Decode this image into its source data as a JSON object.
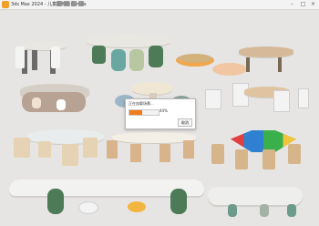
{
  "window": {
    "title": "3ds Max 2024 - 儿童桌椅组合.max",
    "controls": [
      "–",
      "□",
      "×"
    ]
  },
  "dialog": {
    "title": "正在加载场景...",
    "progress_percent": 44,
    "progress_text": "44%",
    "button_label": "取消"
  },
  "colors": {
    "accent": "#f07c1d",
    "app_icon": "#f0a12b"
  }
}
